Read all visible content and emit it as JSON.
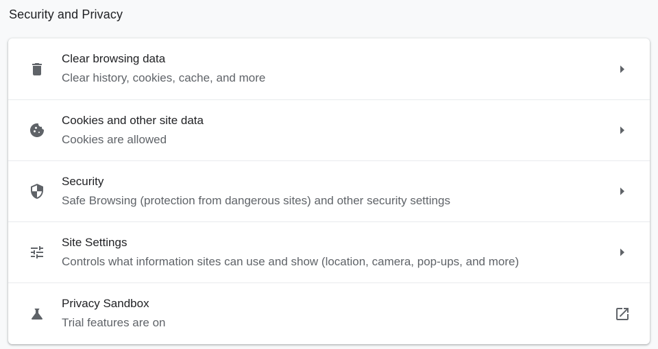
{
  "section": {
    "title": "Security and Privacy"
  },
  "rows": [
    {
      "icon": "trash-icon",
      "label": "Clear browsing data",
      "sublabel": "Clear history, cookies, cache, and more",
      "action_icon": "chevron-right-icon"
    },
    {
      "icon": "cookie-icon",
      "label": "Cookies and other site data",
      "sublabel": "Cookies are allowed",
      "action_icon": "chevron-right-icon"
    },
    {
      "icon": "shield-icon",
      "label": "Security",
      "sublabel": "Safe Browsing (protection from dangerous sites) and other security settings",
      "action_icon": "chevron-right-icon"
    },
    {
      "icon": "tune-icon",
      "label": "Site Settings",
      "sublabel": "Controls what information sites can use and show (location, camera, pop-ups, and more)",
      "action_icon": "chevron-right-icon"
    },
    {
      "icon": "flask-icon",
      "label": "Privacy Sandbox",
      "sublabel": "Trial features are on",
      "action_icon": "open-in-new-icon"
    }
  ],
  "colors": {
    "background": "#f8f9fa",
    "card": "#ffffff",
    "primary_text": "#202124",
    "secondary_text": "#5f6368",
    "divider": "#e8eaed"
  }
}
